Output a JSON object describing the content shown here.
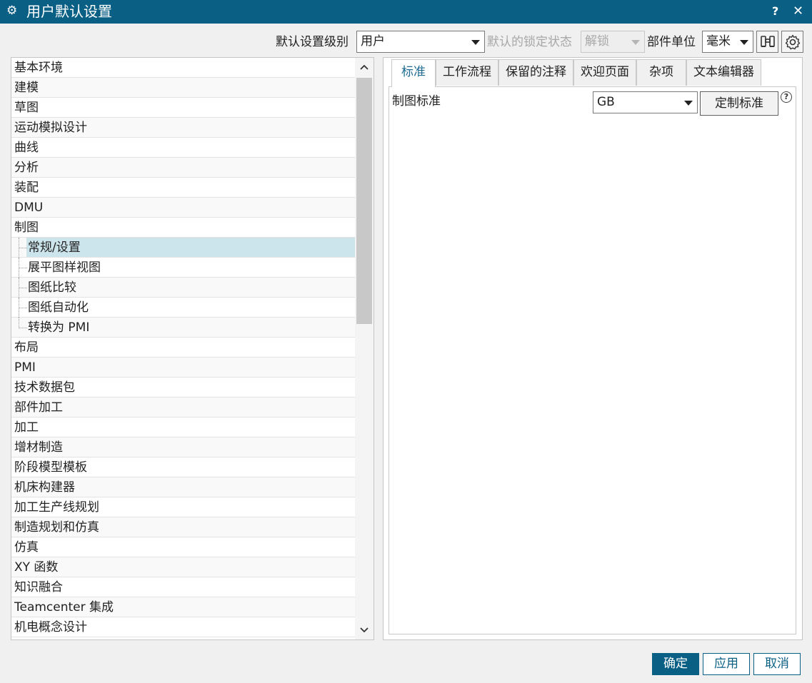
{
  "titlebar": {
    "title": "用户默认设置",
    "help_label": "?",
    "close_label": "✕",
    "gear_glyph": "⚙"
  },
  "toolbar": {
    "level_label": "默认设置级别",
    "level_value": "用户",
    "lock_label": "默认的锁定状态",
    "lock_value": "解锁",
    "unit_label": "部件单位",
    "unit_value": "毫米",
    "find_icon": "binoculars-icon",
    "settings_icon": "gear-icon"
  },
  "tree": {
    "items": [
      {
        "label": "基本环境",
        "level": 0
      },
      {
        "label": "建模",
        "level": 0
      },
      {
        "label": "草图",
        "level": 0
      },
      {
        "label": "运动模拟设计",
        "level": 0
      },
      {
        "label": "曲线",
        "level": 0
      },
      {
        "label": "分析",
        "level": 0
      },
      {
        "label": "装配",
        "level": 0
      },
      {
        "label": "DMU",
        "level": 0
      },
      {
        "label": "制图",
        "level": 0
      },
      {
        "label": "常规/设置",
        "level": 1,
        "selected": true
      },
      {
        "label": "展平图样视图",
        "level": 1
      },
      {
        "label": "图纸比较",
        "level": 1
      },
      {
        "label": "图纸自动化",
        "level": 1
      },
      {
        "label": "转换为 PMI",
        "level": 1,
        "last": true
      },
      {
        "label": "布局",
        "level": 0
      },
      {
        "label": "PMI",
        "level": 0
      },
      {
        "label": "技术数据包",
        "level": 0
      },
      {
        "label": "部件加工",
        "level": 0
      },
      {
        "label": "加工",
        "level": 0
      },
      {
        "label": "增材制造",
        "level": 0
      },
      {
        "label": "阶段模型模板",
        "level": 0
      },
      {
        "label": "机床构建器",
        "level": 0
      },
      {
        "label": "加工生产线规划",
        "level": 0
      },
      {
        "label": "制造规划和仿真",
        "level": 0
      },
      {
        "label": "仿真",
        "level": 0
      },
      {
        "label": "XY 函数",
        "level": 0
      },
      {
        "label": "知识融合",
        "level": 0
      },
      {
        "label": "Teamcenter 集成",
        "level": 0
      },
      {
        "label": "机电概念设计",
        "level": 0
      }
    ]
  },
  "tabs": [
    {
      "label": "标准",
      "active": true
    },
    {
      "label": "工作流程"
    },
    {
      "label": "保留的注释"
    },
    {
      "label": "欢迎页面"
    },
    {
      "label": "杂项"
    },
    {
      "label": "文本编辑器"
    }
  ],
  "standard": {
    "field_label": "制图标准",
    "field_value": "GB",
    "custom_button": "定制标准",
    "help_glyph": "?"
  },
  "footer": {
    "ok": "确定",
    "apply": "应用",
    "cancel": "取消"
  },
  "colors": {
    "accent": "#0a5f85",
    "selected_row": "#cce4ec"
  }
}
